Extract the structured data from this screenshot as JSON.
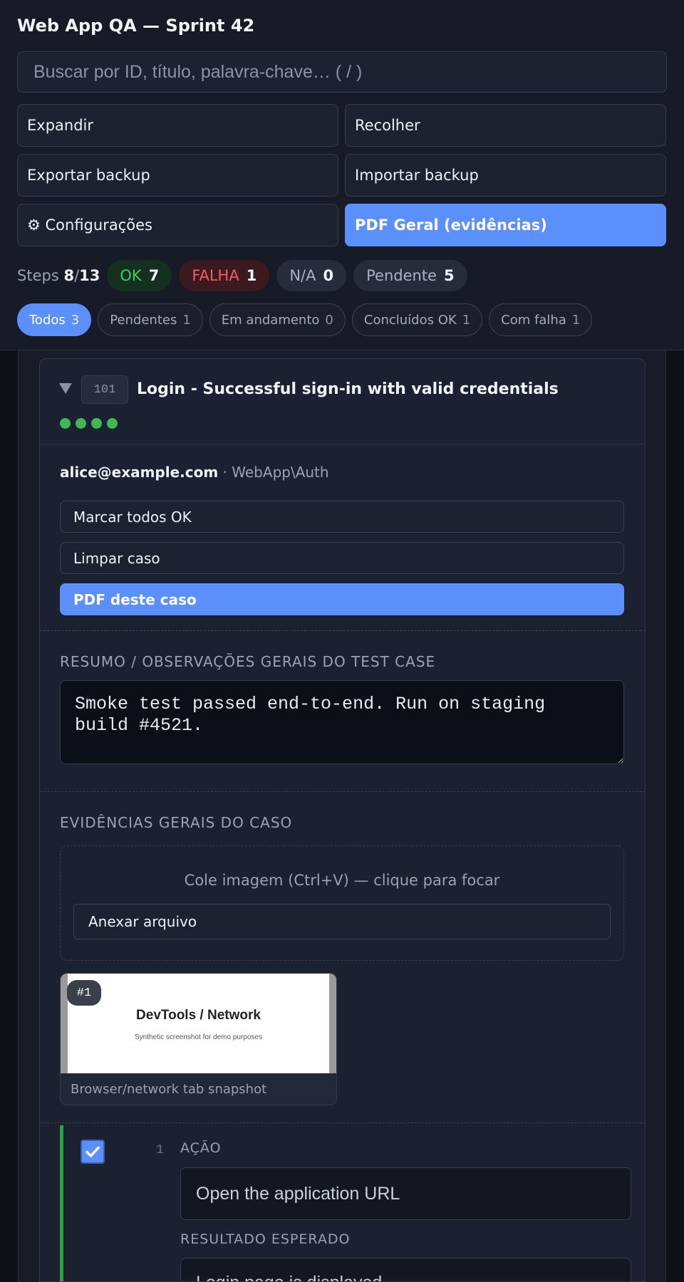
{
  "app": {
    "title": "Web App QA — Sprint 42"
  },
  "search": {
    "placeholder": "Buscar por ID, título, palavra-chave… ( / )"
  },
  "toolbar": {
    "expand": "Expandir",
    "collapse": "Recolher",
    "export_backup": "Exportar backup",
    "import_backup": "Importar backup",
    "settings": "⚙ Configurações",
    "pdf_general": "PDF Geral (evidências)"
  },
  "stats": {
    "steps_label": "Steps",
    "steps_done": "8",
    "steps_total": "13",
    "ok_label": "OK",
    "ok_count": "7",
    "fail_label": "FALHA",
    "fail_count": "1",
    "na_label": "N/A",
    "na_count": "0",
    "pending_label": "Pendente",
    "pending_count": "5"
  },
  "filters": [
    {
      "label": "Todos",
      "count": "3",
      "active": true
    },
    {
      "label": "Pendentes",
      "count": "1"
    },
    {
      "label": "Em andamento",
      "count": "0"
    },
    {
      "label": "Concluídos OK",
      "count": "1"
    },
    {
      "label": "Com falha",
      "count": "1"
    }
  ],
  "case": {
    "id": "101",
    "title": "Login - Successful sign-in with valid credentials",
    "status_dots": [
      "ok",
      "ok",
      "ok",
      "ok"
    ],
    "owner": "alice@example.com",
    "area": "· WebApp\\Auth",
    "btn_mark_all_ok": "Marcar todos OK",
    "btn_clear": "Limpar caso",
    "btn_pdf": "PDF deste caso",
    "summary_label": "RESUMO / OBSERVAÇÕES GERAIS DO TEST CASE",
    "summary_text": "Smoke test passed end-to-end. Run on staging build #4521.",
    "evidence_label": "EVIDÊNCIAS GERAIS DO CASO",
    "paste_hint": "Cole imagem (Ctrl+V) — clique para focar",
    "attach_label": "Anexar arquivo",
    "evidence": [
      {
        "badge": "#1",
        "image_heading": "DevTools / Network",
        "image_sub": "Synthetic screenshot for demo purposes",
        "caption": "Browser/network tab snapshot"
      }
    ],
    "steps": [
      {
        "number": "1",
        "checked": true,
        "action_label": "AÇÃO",
        "action": "Open the application URL",
        "expected_label": "RESULTADO ESPERADO",
        "expected": "Login page is displayed"
      }
    ]
  },
  "colors": {
    "accent": "#5b8ff9",
    "ok": "#3fb950",
    "fail": "#f25d5d",
    "background": "#0d1117"
  }
}
